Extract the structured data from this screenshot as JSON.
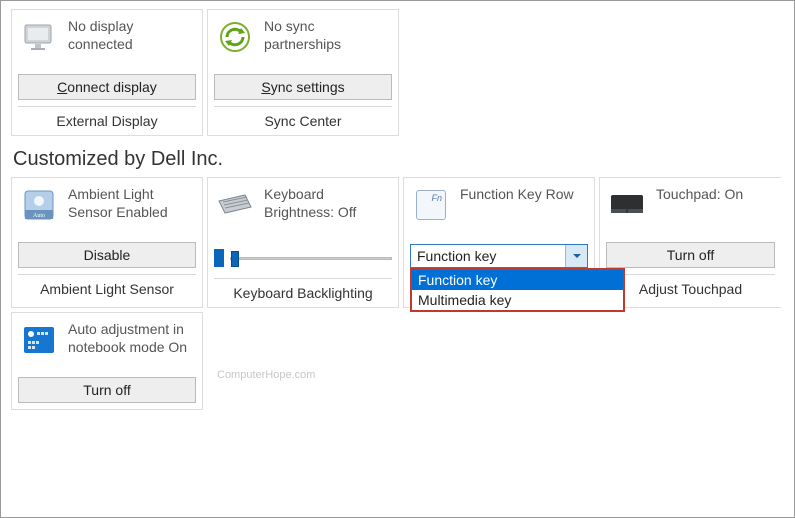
{
  "topRow": {
    "externalDisplay": {
      "status": "No display connected",
      "button": "Connect display",
      "label": "External Display"
    },
    "syncCenter": {
      "status": "No sync partnerships",
      "button": "Sync settings",
      "label": "Sync Center"
    }
  },
  "sectionTitle": "Customized by Dell Inc.",
  "dellRow": {
    "ambientLight": {
      "status": "Ambient Light Sensor Enabled",
      "button": "Disable",
      "label": "Ambient Light Sensor"
    },
    "keyboardBacklight": {
      "status": "Keyboard Brightness: Off",
      "label": "Keyboard Backlighting"
    },
    "functionKey": {
      "status": "Function Key Row",
      "combo": {
        "selected": "Function key",
        "options": [
          "Function key",
          "Multimedia key"
        ]
      }
    },
    "touchpad": {
      "status": "Touchpad: On",
      "button": "Turn off",
      "label": "Adjust Touchpad"
    }
  },
  "dellRow2": {
    "autoAdjust": {
      "status": "Auto adjustment in notebook mode On",
      "button": "Turn off"
    }
  },
  "watermark": "ComputerHope.com"
}
